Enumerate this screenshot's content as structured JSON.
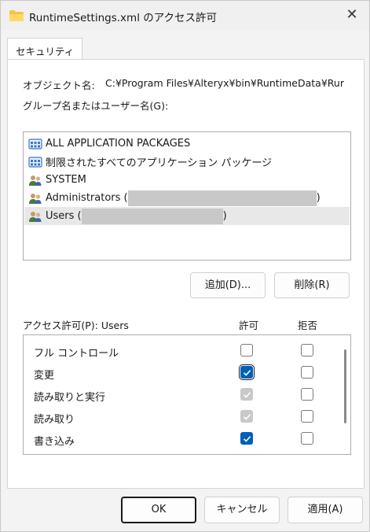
{
  "window": {
    "title": "RuntimeSettings.xml のアクセス許可",
    "close_glyph": "✕"
  },
  "tabs": [
    {
      "label": "セキュリティ"
    }
  ],
  "object": {
    "label": "オブジェクト名:",
    "value": "C:¥Program Files¥Alteryx¥bin¥RuntimeData¥Rur"
  },
  "groups": {
    "label": "グループ名またはユーザー名(G):",
    "items": [
      {
        "label": "ALL APPLICATION PACKAGES",
        "icon": "packages-icon"
      },
      {
        "label": "制限されたすべてのアプリケーション パッケージ",
        "icon": "packages-icon"
      },
      {
        "label": "SYSTEM",
        "icon": "users-icon"
      },
      {
        "label": "Administrators (",
        "suffix": ")",
        "icon": "users-icon",
        "redacted": true
      },
      {
        "label": "Users (",
        "suffix": ")",
        "icon": "users-icon",
        "redacted": true,
        "selected": true
      }
    ],
    "add_button": "追加(D)...",
    "remove_button": "削除(R)"
  },
  "permissions": {
    "header": "アクセス許可(P): Users",
    "allow_header": "許可",
    "deny_header": "拒否",
    "rows": [
      {
        "label": "フル コントロール",
        "allow": "unchecked",
        "deny": "unchecked"
      },
      {
        "label": "変更",
        "allow": "checked",
        "deny": "unchecked"
      },
      {
        "label": "読み取りと実行",
        "allow": "inherited",
        "deny": "unchecked"
      },
      {
        "label": "読み取り",
        "allow": "inherited",
        "deny": "unchecked"
      },
      {
        "label": "書き込み",
        "allow": "checked",
        "deny": "unchecked"
      },
      {
        "label": "",
        "allow": "unchecked",
        "deny": "unchecked"
      }
    ]
  },
  "footer": {
    "ok": "OK",
    "cancel": "キャンセル",
    "apply": "適用(A)"
  },
  "colors": {
    "accent": "#005fb8",
    "inherited_check": "#c9c9c9",
    "selection": "#e8e8e8"
  }
}
